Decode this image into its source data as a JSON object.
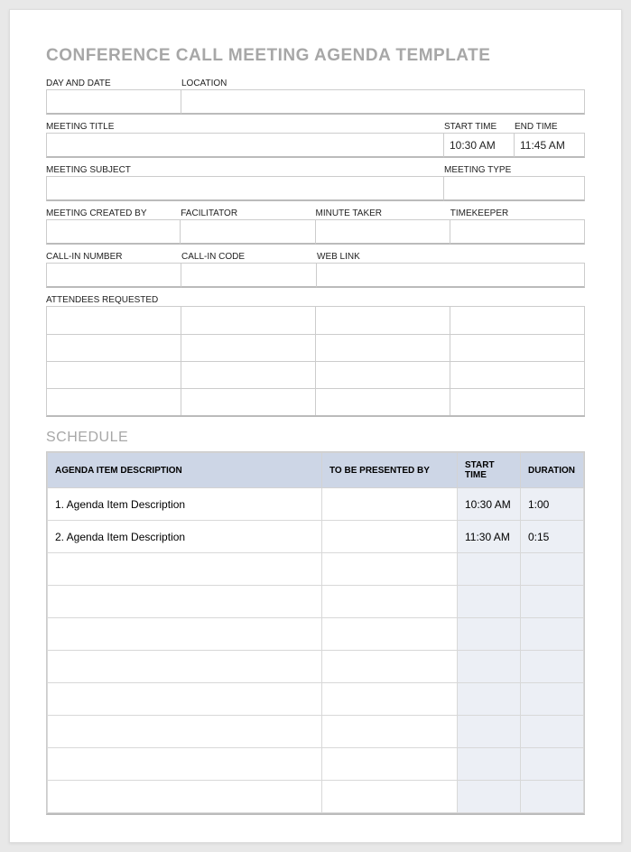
{
  "title": "CONFERENCE CALL MEETING AGENDA TEMPLATE",
  "labels": {
    "day_date": "DAY AND DATE",
    "location": "LOCATION",
    "meeting_title": "MEETING TITLE",
    "start_time": "START TIME",
    "end_time": "END TIME",
    "meeting_subject": "MEETING SUBJECT",
    "meeting_type": "MEETING TYPE",
    "created_by": "MEETING CREATED BY",
    "facilitator": "FACILITATOR",
    "minute_taker": "MINUTE TAKER",
    "timekeeper": "TIMEKEEPER",
    "callin_number": "CALL-IN NUMBER",
    "callin_code": "CALL-IN CODE",
    "web_link": "WEB LINK",
    "attendees": "ATTENDEES REQUESTED"
  },
  "values": {
    "day_date": "",
    "location": "",
    "meeting_title": "",
    "start_time": "10:30 AM",
    "end_time": "11:45 AM",
    "meeting_subject": "",
    "meeting_type": "",
    "created_by": "",
    "facilitator": "",
    "minute_taker": "",
    "timekeeper": "",
    "callin_number": "",
    "callin_code": "",
    "web_link": ""
  },
  "schedule_section": "SCHEDULE",
  "schedule_headers": {
    "desc": "AGENDA ITEM DESCRIPTION",
    "presented": "TO BE PRESENTED BY",
    "start": "START TIME",
    "duration": "DURATION"
  },
  "schedule_rows": [
    {
      "desc": "1. Agenda Item Description",
      "presented": "",
      "start": "10:30 AM",
      "duration": "1:00"
    },
    {
      "desc": "2. Agenda Item Description",
      "presented": "",
      "start": "11:30 AM",
      "duration": "0:15"
    },
    {
      "desc": "",
      "presented": "",
      "start": "",
      "duration": ""
    },
    {
      "desc": "",
      "presented": "",
      "start": "",
      "duration": ""
    },
    {
      "desc": "",
      "presented": "",
      "start": "",
      "duration": ""
    },
    {
      "desc": "",
      "presented": "",
      "start": "",
      "duration": ""
    },
    {
      "desc": "",
      "presented": "",
      "start": "",
      "duration": ""
    },
    {
      "desc": "",
      "presented": "",
      "start": "",
      "duration": ""
    },
    {
      "desc": "",
      "presented": "",
      "start": "",
      "duration": ""
    },
    {
      "desc": "",
      "presented": "",
      "start": "",
      "duration": ""
    }
  ]
}
